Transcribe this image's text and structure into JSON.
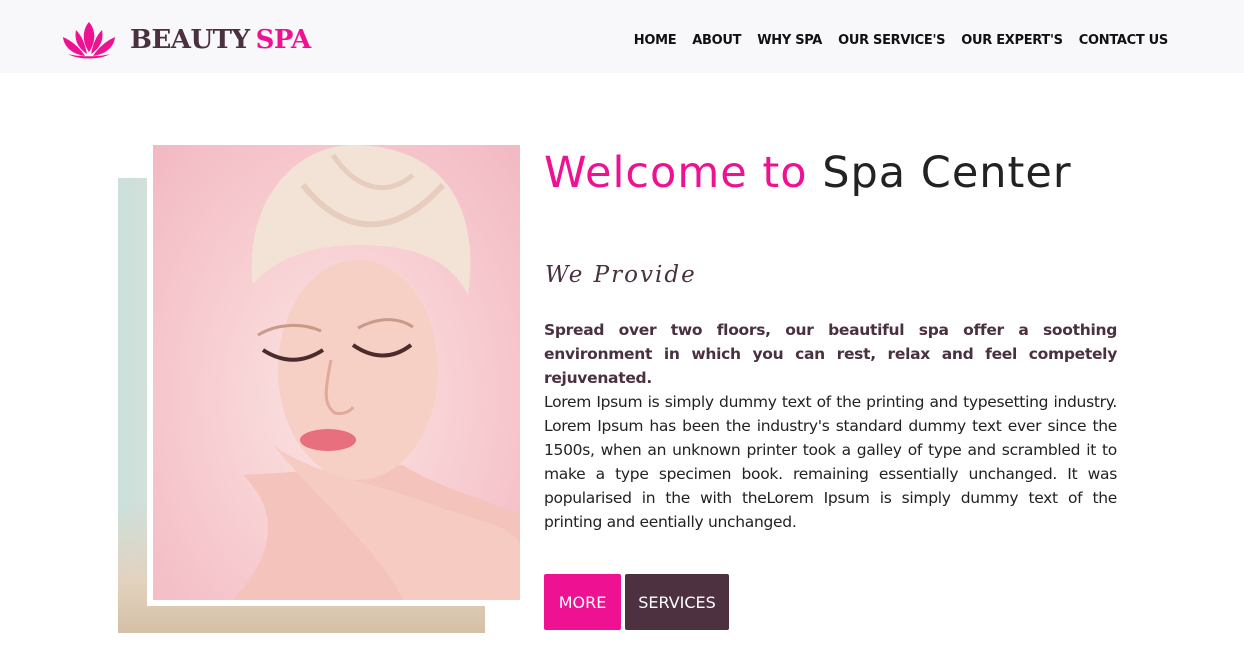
{
  "brand": {
    "word1": "BEAUTY",
    "word2": "SPA",
    "icon": "lotus-icon",
    "primary_color": "#ee1191",
    "secondary_color": "#4a3140"
  },
  "nav": {
    "items": [
      {
        "label": "HOME"
      },
      {
        "label": "ABOUT"
      },
      {
        "label": "WHY SPA"
      },
      {
        "label": "OUR SERVICE'S"
      },
      {
        "label": "OUR EXPERT'S"
      },
      {
        "label": "CONTACT US"
      }
    ]
  },
  "hero": {
    "title_highlight": "Welcome to",
    "title_rest": "Spa Center",
    "subtitle": "We Provide",
    "lead": "Spread over two floors, our beautiful spa offer a soothing environment in which you can rest, relax and feel competely rejuvenated.",
    "body": "Lorem Ipsum is simply dummy text of the printing and typesetting industry. Lorem Ipsum has been the industry's standard dummy text ever since the 1500s, when an unknown printer took a galley of type and scrambled it to make a type specimen book. remaining essentially unchanged. It was popularised in the with theLorem Ipsum is simply dummy text of the printing and eentially unchanged.",
    "buttons": {
      "more": "MORE",
      "services": "SERVICES"
    }
  }
}
